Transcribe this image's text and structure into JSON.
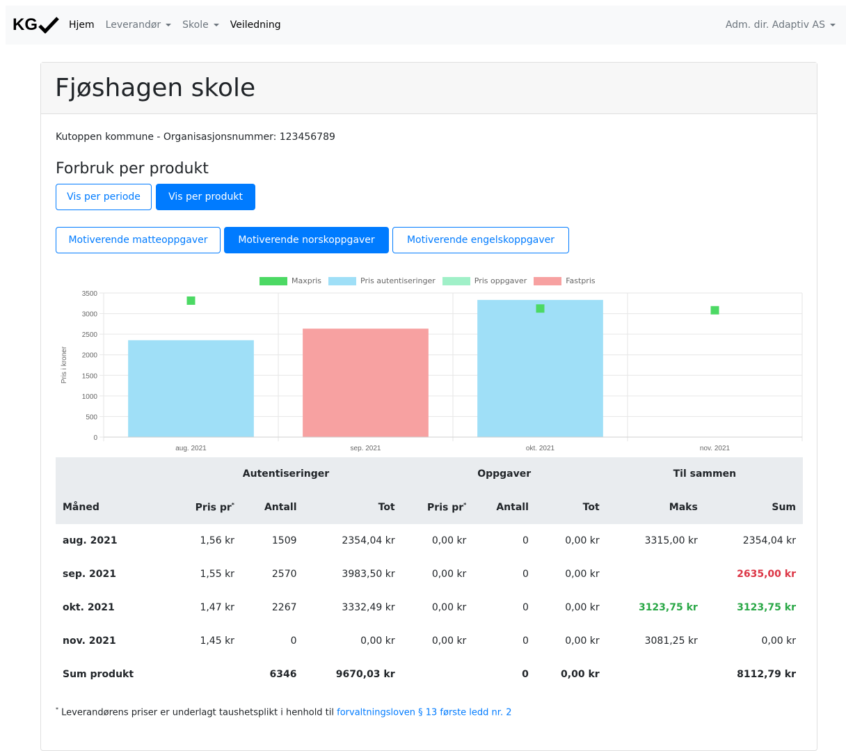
{
  "nav": {
    "brand": "KG",
    "items": [
      {
        "label": "Hjem",
        "active": true,
        "dropdown": false
      },
      {
        "label": "Leverandør",
        "active": false,
        "dropdown": true
      },
      {
        "label": "Skole",
        "active": false,
        "dropdown": true
      },
      {
        "label": "Veiledning",
        "active": true,
        "dropdown": false
      }
    ],
    "user": "Adm. dir. Adaptiv AS"
  },
  "page": {
    "title": "Fjøshagen skole",
    "org_line": "Kutoppen kommune - Organisasjonsnummer: 123456789",
    "section_title": "Forbruk per produkt"
  },
  "view_toggle": {
    "per_period": "Vis per periode",
    "per_product": "Vis per produkt",
    "selected": "per_product"
  },
  "products": [
    {
      "label": "Motiverende matteoppgaver",
      "selected": false
    },
    {
      "label": "Motiverende norskoppgaver",
      "selected": true
    },
    {
      "label": "Motiverende engelskoppgaver",
      "selected": false
    }
  ],
  "chart_data": {
    "type": "bar",
    "ylabel": "Pris i kroner",
    "ylim": [
      0,
      3500
    ],
    "yticks": [
      0,
      500,
      1000,
      1500,
      2000,
      2500,
      3000,
      3500
    ],
    "categories": [
      "aug. 2021",
      "sep. 2021",
      "okt. 2021",
      "nov. 2021"
    ],
    "legend_position": "top",
    "series": [
      {
        "name": "Maxpris",
        "kind": "point",
        "color": "#4cd964",
        "values": [
          3315.0,
          null,
          3123.75,
          3081.25
        ]
      },
      {
        "name": "Pris autentiseringer",
        "kind": "bar",
        "color": "#9fdff7",
        "values": [
          2354.04,
          null,
          3332.49,
          0
        ]
      },
      {
        "name": "Pris oppgaver",
        "kind": "bar",
        "color": "#a0f0c8",
        "values": [
          0,
          0,
          0,
          0
        ]
      },
      {
        "name": "Fastpris",
        "kind": "bar",
        "color": "#f7a1a1",
        "values": [
          null,
          2635.0,
          null,
          null
        ]
      }
    ],
    "grid": true
  },
  "table": {
    "group_headers": [
      "Autentiseringer",
      "Oppgaver",
      "Til sammen"
    ],
    "columns": [
      "Måned",
      "Pris pr",
      "Antall",
      "Tot",
      "Pris pr",
      "Antall",
      "Tot",
      "Maks",
      "Sum"
    ],
    "column_marker": "*",
    "rows": [
      {
        "month": "aug. 2021",
        "auth_price": "1,56 kr",
        "auth_count": "1509",
        "auth_tot": "2354,04 kr",
        "task_price": "0,00 kr",
        "task_count": "0",
        "task_tot": "0,00 kr",
        "max": "3315,00 kr",
        "sum": "2354,04 kr",
        "highlight": ""
      },
      {
        "month": "sep. 2021",
        "auth_price": "1,55 kr",
        "auth_count": "2570",
        "auth_tot": "3983,50 kr",
        "task_price": "0,00 kr",
        "task_count": "0",
        "task_tot": "0,00 kr",
        "max": "",
        "sum": "2635,00 kr",
        "highlight": "red"
      },
      {
        "month": "okt. 2021",
        "auth_price": "1,47 kr",
        "auth_count": "2267",
        "auth_tot": "3332,49 kr",
        "task_price": "0,00 kr",
        "task_count": "0",
        "task_tot": "0,00 kr",
        "max": "3123,75 kr",
        "sum": "3123,75 kr",
        "highlight": "green"
      },
      {
        "month": "nov. 2021",
        "auth_price": "1,45 kr",
        "auth_count": "0",
        "auth_tot": "0,00 kr",
        "task_price": "0,00 kr",
        "task_count": "0",
        "task_tot": "0,00 kr",
        "max": "3081,25 kr",
        "sum": "0,00 kr",
        "highlight": ""
      }
    ],
    "total": {
      "label": "Sum produkt",
      "auth_count": "6346",
      "auth_tot": "9670,03 kr",
      "task_count": "0",
      "task_tot": "0,00 kr",
      "sum": "8112,79 kr"
    }
  },
  "footnote": {
    "marker": "*",
    "text": " Leverandørens priser er underlagt taushetsplikt i henhold til ",
    "link": "forvaltningsloven § 13 første ledd nr. 2"
  }
}
